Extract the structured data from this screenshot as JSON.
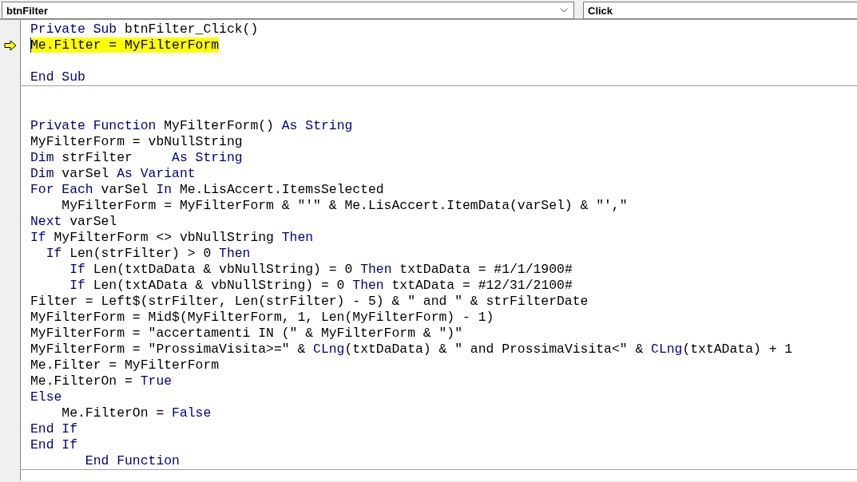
{
  "object_combo": {
    "value": "btnFilter"
  },
  "procedure_combo": {
    "value": "Click"
  },
  "procedures": [
    {
      "lines": [
        {
          "kind": "code",
          "tokens": [
            {
              "kind": "keyword",
              "text": "Private Sub"
            },
            {
              "kind": "plain",
              "text": " btnFilter_Click()"
            }
          ]
        },
        {
          "kind": "code",
          "current": true,
          "tokens": [
            {
              "kind": "plain",
              "text": "Me.Filter = MyFilterForm"
            }
          ]
        },
        {
          "kind": "blank"
        },
        {
          "kind": "code",
          "tokens": [
            {
              "kind": "keyword",
              "text": "End Sub"
            }
          ]
        }
      ]
    },
    {
      "lines": [
        {
          "kind": "blank"
        },
        {
          "kind": "blank"
        },
        {
          "kind": "code",
          "tokens": [
            {
              "kind": "keyword",
              "text": "Private Function"
            },
            {
              "kind": "plain",
              "text": " MyFilterForm() "
            },
            {
              "kind": "keyword",
              "text": "As String"
            }
          ]
        },
        {
          "kind": "code",
          "tokens": [
            {
              "kind": "plain",
              "text": "MyFilterForm = vbNullString"
            }
          ]
        },
        {
          "kind": "code",
          "tokens": [
            {
              "kind": "keyword",
              "text": "Dim"
            },
            {
              "kind": "plain",
              "text": " strFilter     "
            },
            {
              "kind": "keyword",
              "text": "As String"
            }
          ]
        },
        {
          "kind": "code",
          "tokens": [
            {
              "kind": "keyword",
              "text": "Dim"
            },
            {
              "kind": "plain",
              "text": " varSel "
            },
            {
              "kind": "keyword",
              "text": "As Variant"
            }
          ]
        },
        {
          "kind": "code",
          "tokens": [
            {
              "kind": "keyword",
              "text": "For Each"
            },
            {
              "kind": "plain",
              "text": " varSel "
            },
            {
              "kind": "keyword",
              "text": "In"
            },
            {
              "kind": "plain",
              "text": " Me.LisAccert.ItemsSelected"
            }
          ]
        },
        {
          "kind": "code",
          "tokens": [
            {
              "kind": "plain",
              "text": "    MyFilterForm = MyFilterForm & \"'\" & Me.LisAccert.ItemData(varSel) & \"',\""
            }
          ]
        },
        {
          "kind": "code",
          "tokens": [
            {
              "kind": "keyword",
              "text": "Next"
            },
            {
              "kind": "plain",
              "text": " varSel"
            }
          ]
        },
        {
          "kind": "code",
          "tokens": [
            {
              "kind": "keyword",
              "text": "If"
            },
            {
              "kind": "plain",
              "text": " MyFilterForm <> vbNullString "
            },
            {
              "kind": "keyword",
              "text": "Then"
            }
          ]
        },
        {
          "kind": "code",
          "tokens": [
            {
              "kind": "keyword",
              "text": "  If"
            },
            {
              "kind": "plain",
              "text": " Len(strFilter) > 0 "
            },
            {
              "kind": "keyword",
              "text": "Then"
            }
          ]
        },
        {
          "kind": "code",
          "tokens": [
            {
              "kind": "keyword",
              "text": "     If"
            },
            {
              "kind": "plain",
              "text": " Len(txtDaData & vbNullString) = 0 "
            },
            {
              "kind": "keyword",
              "text": "Then"
            },
            {
              "kind": "plain",
              "text": " txtDaData = #1/1/1900#"
            }
          ]
        },
        {
          "kind": "code",
          "tokens": [
            {
              "kind": "keyword",
              "text": "     If"
            },
            {
              "kind": "plain",
              "text": " Len(txtAData & vbNullString) = 0 "
            },
            {
              "kind": "keyword",
              "text": "Then"
            },
            {
              "kind": "plain",
              "text": " txtAData = #12/31/2100#"
            }
          ]
        },
        {
          "kind": "code",
          "tokens": [
            {
              "kind": "plain",
              "text": "Filter = Left$(strFilter, Len(strFilter) - 5) & \" and \" & strFilterDate"
            }
          ]
        },
        {
          "kind": "code",
          "tokens": [
            {
              "kind": "plain",
              "text": "MyFilterForm = Mid$(MyFilterForm, 1, Len(MyFilterForm) - 1)"
            }
          ]
        },
        {
          "kind": "code",
          "tokens": [
            {
              "kind": "plain",
              "text": "MyFilterForm = \"accertamenti IN (\" & MyFilterForm & \")\""
            }
          ]
        },
        {
          "kind": "code",
          "tokens": [
            {
              "kind": "plain",
              "text": "MyFilterForm = \"ProssimaVisita>=\" & "
            },
            {
              "kind": "keyword",
              "text": "CLng"
            },
            {
              "kind": "plain",
              "text": "(txtDaData) & \" and ProssimaVisita<\" & "
            },
            {
              "kind": "keyword",
              "text": "CLng"
            },
            {
              "kind": "plain",
              "text": "(txtAData) + 1"
            }
          ]
        },
        {
          "kind": "code",
          "tokens": [
            {
              "kind": "plain",
              "text": "Me.Filter = MyFilterForm"
            }
          ]
        },
        {
          "kind": "code",
          "tokens": [
            {
              "kind": "plain",
              "text": "Me.FilterOn = "
            },
            {
              "kind": "keyword",
              "text": "True"
            }
          ]
        },
        {
          "kind": "code",
          "tokens": [
            {
              "kind": "keyword",
              "text": "Else"
            }
          ]
        },
        {
          "kind": "code",
          "tokens": [
            {
              "kind": "plain",
              "text": "    Me.FilterOn = "
            },
            {
              "kind": "keyword",
              "text": "False"
            }
          ]
        },
        {
          "kind": "code",
          "tokens": [
            {
              "kind": "keyword",
              "text": "End If"
            }
          ]
        },
        {
          "kind": "code",
          "tokens": [
            {
              "kind": "keyword",
              "text": "End If"
            }
          ]
        },
        {
          "kind": "code",
          "tokens": [
            {
              "kind": "keyword",
              "text": "       End Function"
            }
          ]
        }
      ]
    }
  ]
}
